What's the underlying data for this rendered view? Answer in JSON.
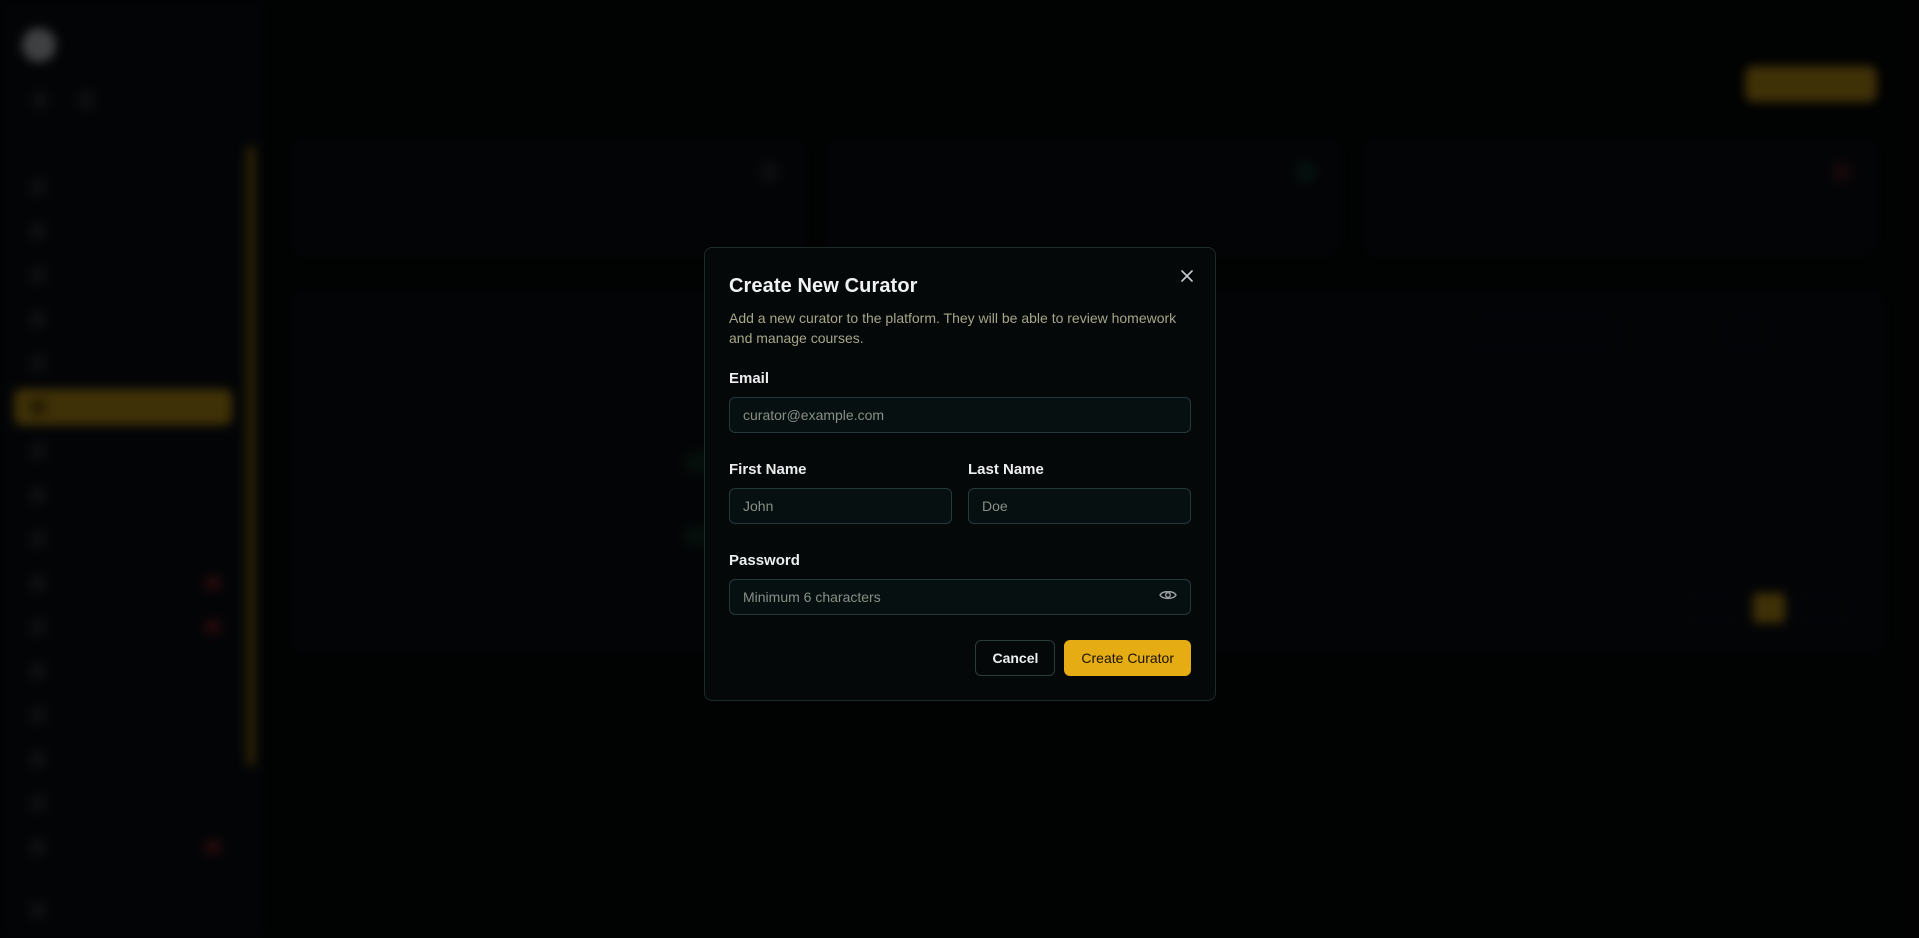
{
  "colors": {
    "accent": "#e5ac14",
    "modal_bg": "#050809",
    "input_bg": "#061011",
    "input_border": "#23393c",
    "desc_text": "#a6a689"
  },
  "modal": {
    "title": "Create New Curator",
    "description": "Add a new curator to the platform. They will be able to review homework and manage courses.",
    "close_icon": "close-icon",
    "email": {
      "label": "Email",
      "value": "",
      "placeholder": "curator@example.com"
    },
    "first_name": {
      "label": "First Name",
      "value": "",
      "placeholder": "John"
    },
    "last_name": {
      "label": "Last Name",
      "value": "",
      "placeholder": "Doe"
    },
    "password": {
      "label": "Password",
      "value": "",
      "placeholder": "Minimum 6 characters",
      "toggle_icon": "eye-icon"
    },
    "cancel_label": "Cancel",
    "create_label": "Create Curator"
  }
}
